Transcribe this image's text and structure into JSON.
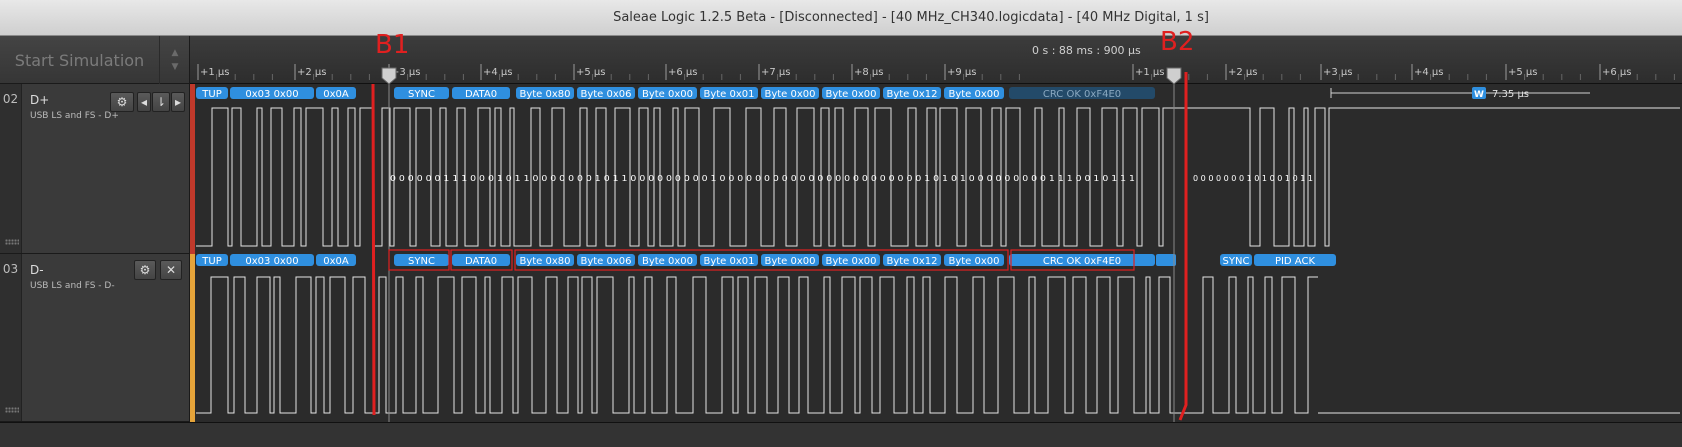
{
  "window": {
    "title": "Saleae Logic 1.2.5 Beta - [Disconnected] - [40 MHz_CH340.logicdata] - [40 MHz Digital, 1 s]"
  },
  "simulation": {
    "button_label": "Start Simulation",
    "up_arrow": "▲",
    "down_arrow": "▼"
  },
  "ruler": {
    "time_position": "0 s : 88 ms : 900 μs",
    "ticks": [
      "+1 μs",
      "+2 μs",
      "+3 μs",
      "+4 μs",
      "+5 μs",
      "+6 μs",
      "+7 μs",
      "+8 μs",
      "+9 μs",
      "+1 μs",
      "+2 μs",
      "+3 μs",
      "+4 μs",
      "+5 μs",
      "+6 μs"
    ],
    "measurement": {
      "badge": "W",
      "value": "7.35 μs"
    }
  },
  "channels": [
    {
      "number": "02",
      "name": "D+",
      "subtitle": "USB LS and FS - D+",
      "buttons": {
        "settings": "⚙",
        "prev": "◂",
        "edge": "⇂",
        "next": "▸"
      },
      "bits_left": "0 0 0 0 0 0 1 1 1 0 0 0 1 0 1 1 0 0 0 0 0 0 0 1 0 1 1 0 0 0 0 0 0 0 0 0 1 0 0 0 0 0 0 0 0 0 0 0 0 0 0 0 0 0 0 0 0 0 0 0 1 0 1 0 1 0 0 0 0 0 0 0 0 0 1 1 1 0 0 1 0 1 1 1",
      "bits_right": "0 0 0 0 0 0 0 1 0 1 0 0 1 0 1 1"
    },
    {
      "number": "03",
      "name": "D-",
      "subtitle": "USB LS and FS - D-",
      "buttons": {
        "settings": "⚙",
        "close": "✕"
      }
    }
  ],
  "decoder": {
    "top": [
      "TUP",
      "0x03 0x00",
      "0x0A",
      "SYNC",
      "DATA0",
      "Byte 0x80",
      "Byte 0x06",
      "Byte 0x00",
      "Byte 0x01",
      "Byte 0x00",
      "Byte 0x00",
      "Byte 0x12",
      "Byte 0x00",
      "CRC OK 0xF4E0"
    ],
    "bottom": [
      "TUP",
      "0x03 0x00",
      "0x0A",
      "SYNC",
      "DATA0",
      "Byte 0x80",
      "Byte 0x06",
      "Byte 0x00",
      "Byte 0x01",
      "Byte 0x00",
      "Byte 0x00",
      "Byte 0x12",
      "Byte 0x00",
      "CRC OK 0xF4E0",
      "SYNC",
      "PID ACK"
    ]
  },
  "markers": {
    "b1": "B1",
    "b2": "B2"
  },
  "colors": {
    "decoder_bubble": "#2f8fdf",
    "decoder_bubble_dim": "#234a69",
    "waveform": "#e4e4e4",
    "annotation_red": "#e02020",
    "d_plus_strip": "#c0392b",
    "d_minus_strip": "#e6a43a"
  },
  "icons": {
    "settings": "gear-icon",
    "marker": "flag-icon"
  }
}
